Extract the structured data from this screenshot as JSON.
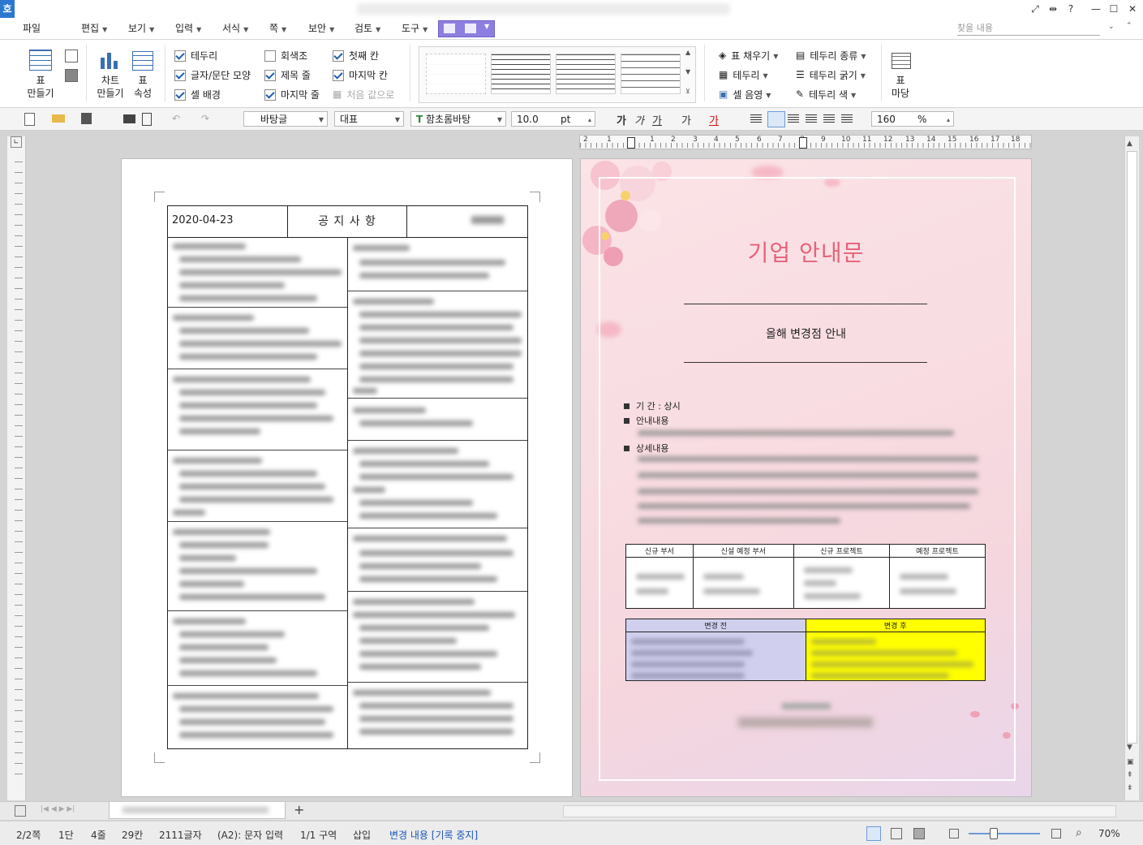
{
  "menu": [
    "파일",
    "편집",
    "보기",
    "입력",
    "서식",
    "쪽",
    "보안",
    "검토",
    "도구"
  ],
  "find_placeholder": "찾을 내용",
  "ribbon": {
    "table_make": "표",
    "table_make2": "만들기",
    "chart_make": "차트",
    "chart_make2": "만들기",
    "table_props": "표",
    "table_props2": "속성",
    "checks": [
      {
        "label": "테두리",
        "on": true
      },
      {
        "label": "글자/문단 모양",
        "on": true
      },
      {
        "label": "셀 배경",
        "on": true
      },
      {
        "label": "회색조",
        "on": false
      },
      {
        "label": "제목 줄",
        "on": true
      },
      {
        "label": "마지막 줄",
        "on": true
      },
      {
        "label": "첫째 칸",
        "on": true
      },
      {
        "label": "마지막 칸",
        "on": true
      },
      {
        "label": "처음 값으로",
        "on": false
      }
    ],
    "right": [
      "표 채우기",
      "테두리",
      "셀 음영",
      "테두리 종류",
      "테두리 굵기",
      "테두리 색"
    ],
    "table_madang": "표",
    "table_madang2": "마당"
  },
  "toolbar": {
    "style": "바탕글",
    "lang": "대표",
    "font": "함초롬바탕",
    "size": "10.0",
    "unit": "pt",
    "zoom": "160",
    "zoom_unit": "%",
    "fmt": [
      "가",
      "가",
      "가",
      "가",
      "가"
    ]
  },
  "ruler_numbers": [
    "2",
    "1",
    "1",
    "2",
    "3",
    "4",
    "5",
    "6",
    "7",
    "8",
    "9",
    "10",
    "11",
    "12",
    "13",
    "14",
    "15",
    "16",
    "17",
    "18"
  ],
  "notice": {
    "date": "2020-04-23",
    "title": "공 지 사 항"
  },
  "flyer": {
    "title": "기업 안내문",
    "subtitle": "올해 변경점 안내",
    "period_label": "기    간",
    "period_value": ": 상시",
    "guide_label": "안내내용",
    "detail_label": "상세내용",
    "table1_headers": [
      "신규 부서",
      "신설 예정 부서",
      "신규 프로젝트",
      "예정 프로젝트"
    ],
    "table2_headers": [
      "변경 전",
      "변경 후"
    ],
    "colors": {
      "title": "#e8617a",
      "after_bg": "#ffff00",
      "before_bg": "#d0d0ee"
    }
  },
  "status": {
    "page": "2/2쪽",
    "col": "1단",
    "line": "4줄",
    "char_col": "29칸",
    "chars": "2111글자",
    "input": "(A2): 문자 입력",
    "section": "1/1 구역",
    "insert": "삽입",
    "track": "변경 내용 [기록 중지]",
    "zoom": "70%"
  }
}
